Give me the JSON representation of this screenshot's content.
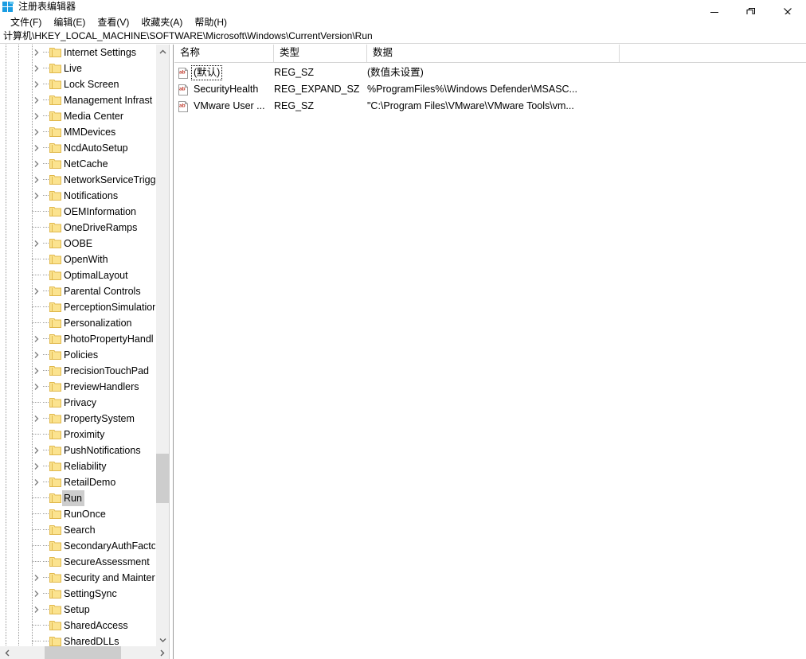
{
  "window": {
    "title": "注册表编辑器",
    "icon": "registry-editor-icon",
    "controls": {
      "minimize": "minimize-icon",
      "maximize": "restore-icon",
      "close": "close-icon"
    }
  },
  "menubar": {
    "items": [
      {
        "label": "文件(F)"
      },
      {
        "label": "编辑(E)"
      },
      {
        "label": "查看(V)"
      },
      {
        "label": "收藏夹(A)"
      },
      {
        "label": "帮助(H)"
      }
    ]
  },
  "address": {
    "path": "计算机\\HKEY_LOCAL_MACHINE\\SOFTWARE\\Microsoft\\Windows\\CurrentVersion\\Run"
  },
  "tree": {
    "items": [
      {
        "label": "Internet Settings",
        "expandable": true,
        "selected": false
      },
      {
        "label": "Live",
        "expandable": true,
        "selected": false
      },
      {
        "label": "Lock Screen",
        "expandable": true,
        "selected": false
      },
      {
        "label": "Management Infrast",
        "expandable": true,
        "selected": false
      },
      {
        "label": "Media Center",
        "expandable": true,
        "selected": false
      },
      {
        "label": "MMDevices",
        "expandable": true,
        "selected": false
      },
      {
        "label": "NcdAutoSetup",
        "expandable": true,
        "selected": false
      },
      {
        "label": "NetCache",
        "expandable": true,
        "selected": false
      },
      {
        "label": "NetworkServiceTrigg",
        "expandable": true,
        "selected": false
      },
      {
        "label": "Notifications",
        "expandable": true,
        "selected": false
      },
      {
        "label": "OEMInformation",
        "expandable": false,
        "selected": false
      },
      {
        "label": "OneDriveRamps",
        "expandable": false,
        "selected": false
      },
      {
        "label": "OOBE",
        "expandable": true,
        "selected": false
      },
      {
        "label": "OpenWith",
        "expandable": false,
        "selected": false
      },
      {
        "label": "OptimalLayout",
        "expandable": false,
        "selected": false
      },
      {
        "label": "Parental Controls",
        "expandable": true,
        "selected": false
      },
      {
        "label": "PerceptionSimulation",
        "expandable": false,
        "selected": false
      },
      {
        "label": "Personalization",
        "expandable": false,
        "selected": false
      },
      {
        "label": "PhotoPropertyHandl",
        "expandable": true,
        "selected": false
      },
      {
        "label": "Policies",
        "expandable": true,
        "selected": false
      },
      {
        "label": "PrecisionTouchPad",
        "expandable": true,
        "selected": false
      },
      {
        "label": "PreviewHandlers",
        "expandable": true,
        "selected": false
      },
      {
        "label": "Privacy",
        "expandable": false,
        "selected": false
      },
      {
        "label": "PropertySystem",
        "expandable": true,
        "selected": false
      },
      {
        "label": "Proximity",
        "expandable": false,
        "selected": false
      },
      {
        "label": "PushNotifications",
        "expandable": true,
        "selected": false
      },
      {
        "label": "Reliability",
        "expandable": true,
        "selected": false
      },
      {
        "label": "RetailDemo",
        "expandable": true,
        "selected": false
      },
      {
        "label": "Run",
        "expandable": false,
        "selected": true
      },
      {
        "label": "RunOnce",
        "expandable": false,
        "selected": false
      },
      {
        "label": "Search",
        "expandable": false,
        "selected": false
      },
      {
        "label": "SecondaryAuthFacto",
        "expandable": false,
        "selected": false
      },
      {
        "label": "SecureAssessment",
        "expandable": false,
        "selected": false
      },
      {
        "label": "Security and Mainter",
        "expandable": true,
        "selected": false
      },
      {
        "label": "SettingSync",
        "expandable": true,
        "selected": false
      },
      {
        "label": "Setup",
        "expandable": true,
        "selected": false
      },
      {
        "label": "SharedAccess",
        "expandable": false,
        "selected": false
      },
      {
        "label": "SharedDLLs",
        "expandable": false,
        "selected": false
      }
    ]
  },
  "list": {
    "columns": [
      {
        "label": "名称"
      },
      {
        "label": "类型"
      },
      {
        "label": "数据"
      }
    ],
    "rows": [
      {
        "name": "(默认)",
        "type": "REG_SZ",
        "data": "(数值未设置)",
        "icon": "string-value-icon",
        "focused": true
      },
      {
        "name": "SecurityHealth",
        "type": "REG_EXPAND_SZ",
        "data": "%ProgramFiles%\\Windows Defender\\MSASC...",
        "icon": "string-value-icon",
        "focused": false
      },
      {
        "name": "VMware User ...",
        "type": "REG_SZ",
        "data": "\"C:\\Program Files\\VMware\\VMware Tools\\vm...",
        "icon": "string-value-icon",
        "focused": false
      }
    ]
  },
  "scrollbars": {
    "tree_vertical": {
      "up_arrow": "chevron-up-icon",
      "down_arrow": "chevron-down-icon"
    },
    "tree_horizontal": {
      "left_arrow": "chevron-left-icon",
      "right_arrow": "chevron-right-icon"
    }
  },
  "colors": {
    "folder": "#fbe38f",
    "folder_edge": "#e0b84c",
    "selection": "#cdcdcd",
    "scroll_track": "#f0f0f0",
    "scroll_thumb": "#cdcdcd",
    "icon_accent": "#c0392b",
    "title_icon": "#1b9de2"
  }
}
